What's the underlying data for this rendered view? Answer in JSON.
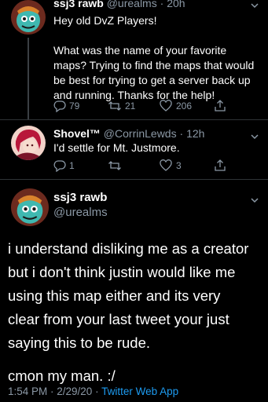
{
  "tweet1": {
    "display_name": "ssj3 rawb",
    "handle": "@urealms",
    "time": "20h",
    "text_line1": "Hey old DvZ Players!",
    "text_para": [
      "What was the name of your favorite",
      "maps? Trying to find the maps that would",
      "be best for trying to get a server back up",
      "and running. Thanks for the help!"
    ],
    "replies": "79",
    "retweets": "21",
    "likes": "206"
  },
  "tweet2": {
    "display_name": "Shovel™",
    "handle": "@CorrinLewds",
    "time": "12h",
    "text": "I'd settle for Mt. Justmore.",
    "replies": "1",
    "retweets": "",
    "likes": "3"
  },
  "main_tweet": {
    "display_name": "ssj3 rawb",
    "handle": "@urealms",
    "text_lines": [
      "i understand disliking me as a creator",
      "but i don't think justin would like me",
      "using this map either and its very",
      "clear from your last tweet your just",
      "saying this to be rude."
    ],
    "text_final": "cmon my man. :/",
    "timestamp": "1:54 PM · 2/29/20 · ",
    "source": "Twitter Web App"
  },
  "colors": {
    "background": "#000000",
    "muted": "#8b98a5",
    "link": "#1d9bf0"
  },
  "icons": [
    "reply-icon",
    "retweet-icon",
    "like-icon",
    "share-icon",
    "chevron-down-icon"
  ]
}
